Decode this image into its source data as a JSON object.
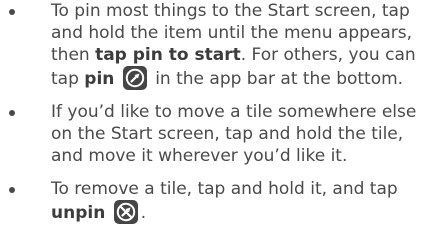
{
  "bullets": [
    {
      "segments": [
        "To pin most things to the Start screen, tap and hold the item until the menu appears, then ",
        "tap pin to start",
        ". For others, you can tap ",
        "pin",
        " in the app bar at the bottom."
      ],
      "icon": "pin-icon"
    },
    {
      "text": "If you’d like to move a tile somewhere else on the Start screen, tap and hold the tile, and move it wherever you’d like it."
    },
    {
      "segments": [
        "To remove a tile, tap and hold it, and tap ",
        "unpin",
        "."
      ],
      "icon": "unpin-icon"
    }
  ]
}
